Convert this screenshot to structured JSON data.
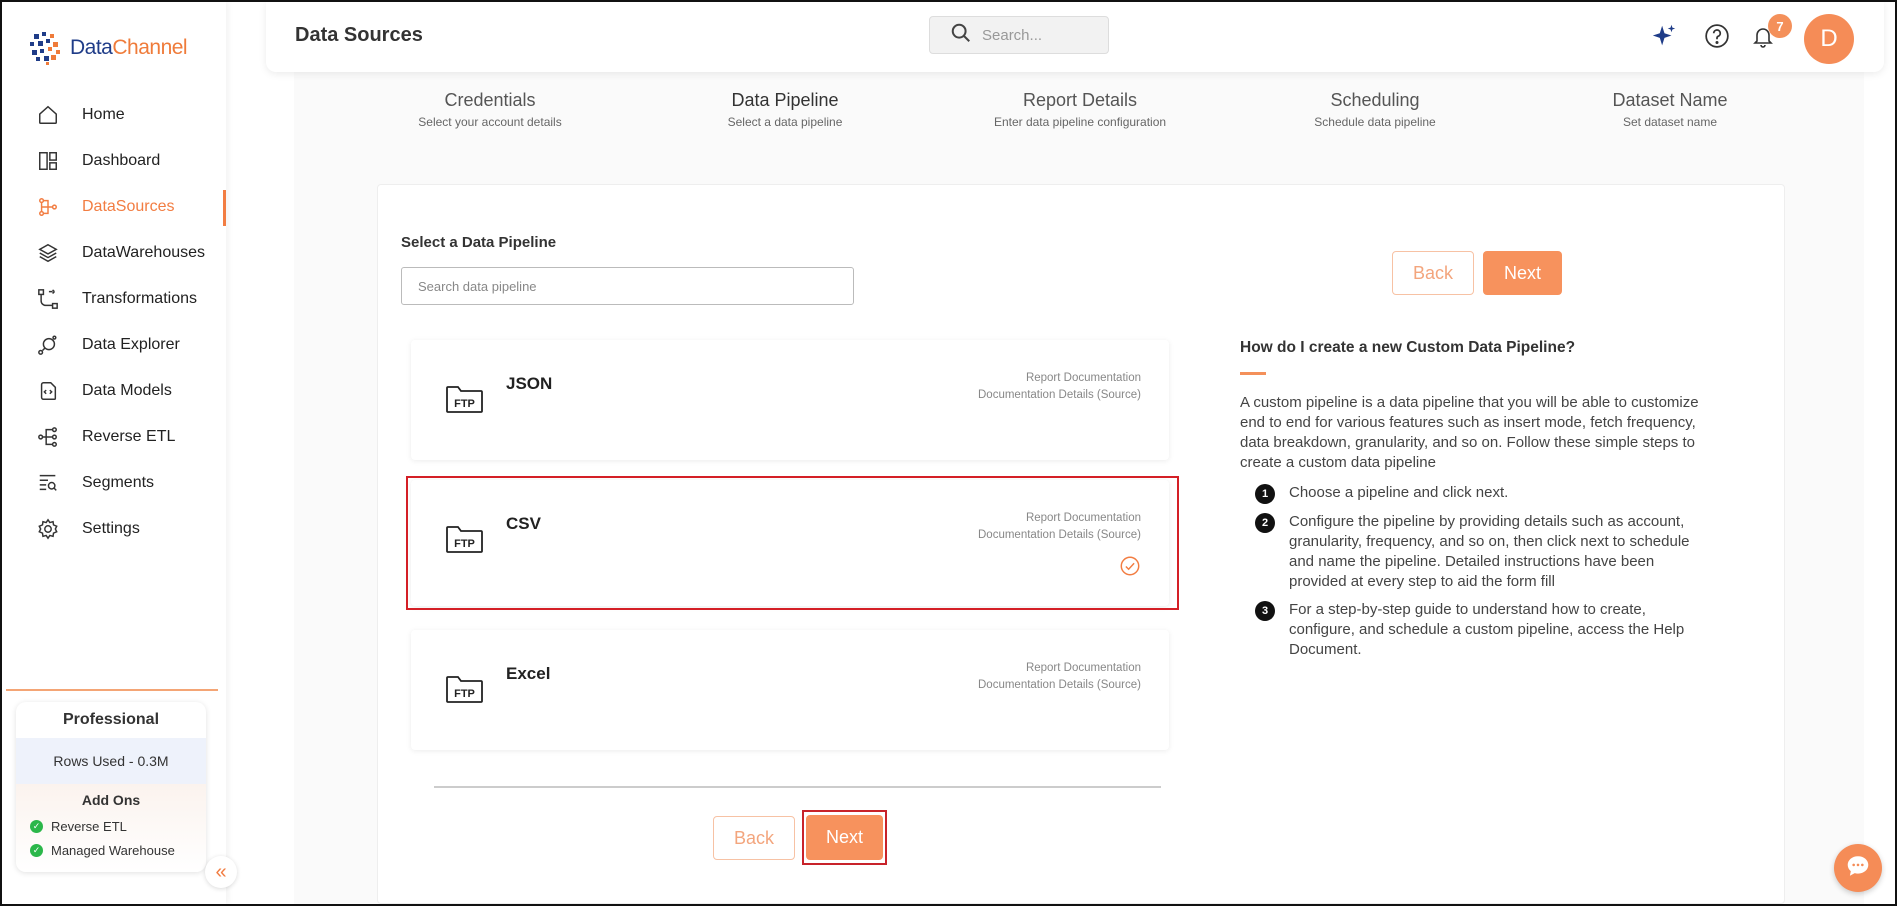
{
  "app": {
    "logo_part1": "Data",
    "logo_part2": "Channel"
  },
  "sidebar": {
    "items": [
      {
        "label": "Home",
        "icon": "home-icon"
      },
      {
        "label": "Dashboard",
        "icon": "dashboard-icon"
      },
      {
        "label": "DataSources",
        "icon": "datasources-icon",
        "active": true
      },
      {
        "label": "DataWarehouses",
        "icon": "layers-icon"
      },
      {
        "label": "Transformations",
        "icon": "transformations-icon"
      },
      {
        "label": "Data Explorer",
        "icon": "explorer-icon"
      },
      {
        "label": "Data Models",
        "icon": "data-models-icon"
      },
      {
        "label": "Reverse ETL",
        "icon": "reverse-etl-icon"
      },
      {
        "label": "Segments",
        "icon": "segments-icon"
      },
      {
        "label": "Settings",
        "icon": "gear-icon"
      }
    ],
    "plan": {
      "title": "Professional",
      "rows_used": "Rows Used - 0.3M",
      "addons_title": "Add Ons",
      "addons": [
        "Reverse ETL",
        "Managed Warehouse"
      ]
    }
  },
  "header": {
    "title": "Data Sources",
    "search_placeholder": "Search...",
    "notification_count": "7",
    "avatar_initial": "D"
  },
  "steps": [
    {
      "title": "Credentials",
      "subtitle": "Select your account details"
    },
    {
      "title": "Data Pipeline",
      "subtitle": "Select a data pipeline",
      "active": true
    },
    {
      "title": "Report Details",
      "subtitle": "Enter data pipeline configuration"
    },
    {
      "title": "Scheduling",
      "subtitle": "Schedule data pipeline"
    },
    {
      "title": "Dataset Name",
      "subtitle": "Set dataset name"
    }
  ],
  "main": {
    "section_title": "Select a Data Pipeline",
    "search_placeholder": "Search data pipeline",
    "pipelines": [
      {
        "name": "JSON",
        "icon": "ftp-folder-icon",
        "doc1": "Report Documentation",
        "doc2": "Documentation Details (Source)",
        "selected": false
      },
      {
        "name": "CSV",
        "icon": "ftp-folder-icon",
        "doc1": "Report Documentation",
        "doc2": "Documentation Details (Source)",
        "selected": true
      },
      {
        "name": "Excel",
        "icon": "ftp-folder-icon",
        "doc1": "Report Documentation",
        "doc2": "Documentation Details (Source)",
        "selected": false
      }
    ],
    "ftp_label": "FTP",
    "back_label": "Back",
    "next_label": "Next"
  },
  "help": {
    "title": "How do I create a new Custom Data Pipeline?",
    "body": "A custom pipeline is a data pipeline that you will be able to customize end to end for various features such as insert mode, fetch frequency, data breakdown, granularity, and so on. Follow these simple steps to create a custom data pipeline",
    "steps": [
      {
        "num": "1",
        "text": "Choose a pipeline and click next."
      },
      {
        "num": "2",
        "text": "Configure the pipeline by providing details such as account, granularity, frequency, and so on, then click next to schedule and name the pipeline. Detailed instructions have been provided at every step to aid the form fill"
      },
      {
        "num": "3",
        "text": "For a step-by-step guide to understand how to create, configure, and schedule a custom pipeline, access the Help Document."
      }
    ]
  },
  "colors": {
    "accent": "#f27d42",
    "button": "#f7925d",
    "selection_outline": "#d41f26",
    "check_green": "#2bb74a"
  }
}
